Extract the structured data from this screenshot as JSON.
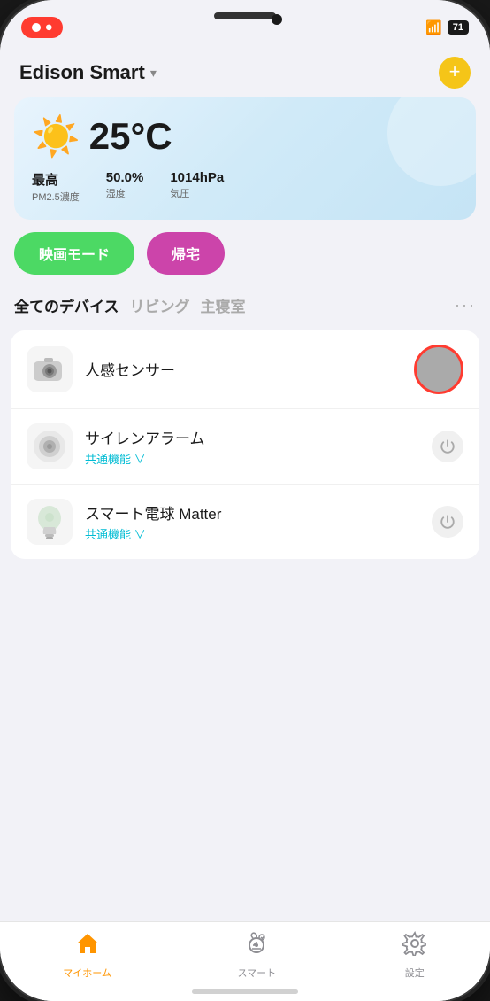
{
  "status_bar": {
    "recording_label": "●",
    "rec_text": "⏺",
    "battery": "71",
    "wifi": "WiFi"
  },
  "header": {
    "title": "Edison Smart",
    "dropdown_arrow": "▾",
    "add_button_label": "+"
  },
  "weather": {
    "icon": "☀️",
    "temperature": "25°C",
    "pm25_label": "最高",
    "pm25_sublabel": "PM2.5濃度",
    "humidity_value": "50.0%",
    "humidity_label": "湿度",
    "pressure_value": "1014hPa",
    "pressure_label": "気圧"
  },
  "scenes": [
    {
      "label": "映画モード",
      "color": "#4cd964"
    },
    {
      "label": "帰宅",
      "color": "#cc44aa"
    }
  ],
  "device_tabs": [
    {
      "label": "全てのデバイス",
      "active": true
    },
    {
      "label": "リビング",
      "active": false
    },
    {
      "label": "主寝室",
      "active": false
    }
  ],
  "devices": [
    {
      "name": "人感センサー",
      "sub": "",
      "control_type": "motion",
      "icon_type": "camera"
    },
    {
      "name": "サイレンアラーム",
      "sub": "共通機能 ∨",
      "control_type": "power",
      "icon_type": "siren"
    },
    {
      "name": "スマート電球 Matter",
      "sub": "共通機能 ∨",
      "control_type": "power",
      "icon_type": "bulb"
    }
  ],
  "bottom_nav": [
    {
      "label": "マイホーム",
      "active": true,
      "icon": "home"
    },
    {
      "label": "スマート",
      "active": false,
      "icon": "smart"
    },
    {
      "label": "設定",
      "active": false,
      "icon": "settings"
    }
  ]
}
